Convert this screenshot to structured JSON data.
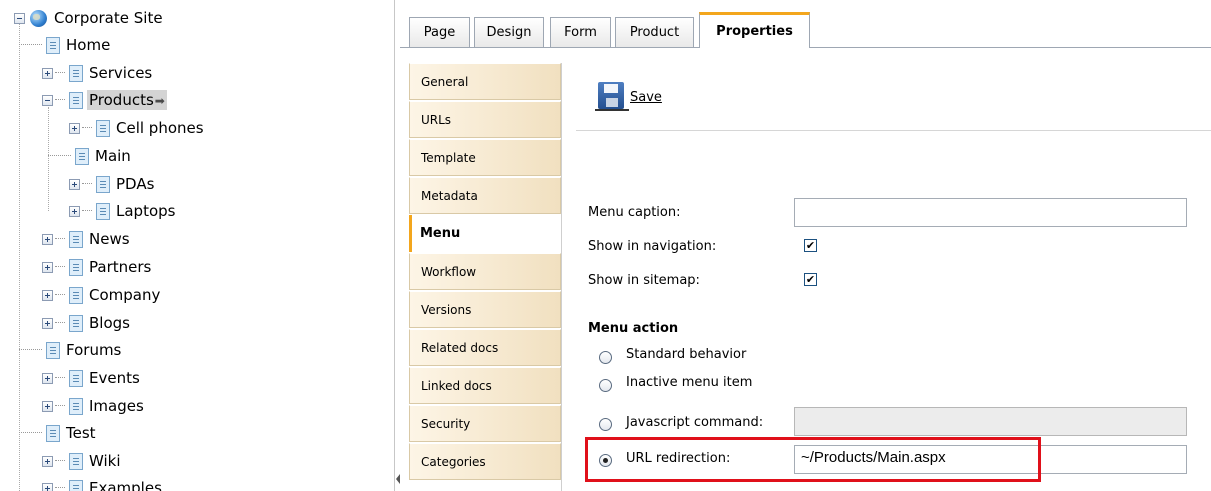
{
  "tree": {
    "root": "Corporate Site",
    "items": [
      {
        "label": "Home"
      },
      {
        "label": "Services"
      },
      {
        "label": "Products"
      },
      {
        "label": "Cell phones"
      },
      {
        "label": "Main"
      },
      {
        "label": "PDAs"
      },
      {
        "label": "Laptops"
      },
      {
        "label": "News"
      },
      {
        "label": "Partners"
      },
      {
        "label": "Company"
      },
      {
        "label": "Blogs"
      },
      {
        "label": "Forums"
      },
      {
        "label": "Events"
      },
      {
        "label": "Images"
      },
      {
        "label": "Test"
      },
      {
        "label": "Wiki"
      },
      {
        "label": "Examples"
      }
    ],
    "selected": "Products",
    "selected_arrow": "➡"
  },
  "top_tabs": [
    "Page",
    "Design",
    "Form",
    "Product",
    "Properties"
  ],
  "active_top_tab": "Properties",
  "side_tabs": [
    "General",
    "URLs",
    "Template",
    "Metadata",
    "Menu",
    "Workflow",
    "Versions",
    "Related docs",
    "Linked docs",
    "Security",
    "Categories"
  ],
  "active_side_tab": "Menu",
  "toolbar": {
    "save_label": "Save"
  },
  "form": {
    "menu_caption_label": "Menu caption:",
    "menu_caption_value": "",
    "show_in_navigation_label": "Show in navigation:",
    "show_in_navigation": true,
    "show_in_sitemap_label": "Show in sitemap:",
    "show_in_sitemap": true,
    "menu_action_title": "Menu action",
    "options": {
      "standard": "Standard behavior",
      "inactive": "Inactive menu item",
      "javascript": "Javascript command:",
      "url": "URL redirection:"
    },
    "selected_option": "url",
    "javascript_value": "",
    "url_value": "~/Products/Main.aspx",
    "check_mark": "✔"
  },
  "colors": {
    "accent": "#f3a61d",
    "highlight": "#e0101a",
    "side_tab_bg": "#f6ead2"
  }
}
